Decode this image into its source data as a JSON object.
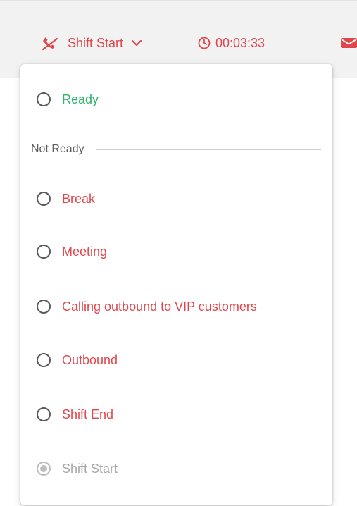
{
  "header": {
    "status_label": "Shift Start",
    "timer": "00:03:33"
  },
  "icons": {
    "status": "phone-off-icon",
    "toggle": "chevron-down-icon",
    "timer": "clock-icon",
    "mail": "mail-icon"
  },
  "colors": {
    "accent_red": "#e0474c",
    "ready_green": "#2cb56b",
    "disabled_gray": "#a8a8a8"
  },
  "menu": {
    "ready": {
      "label": "Ready",
      "selected": false
    },
    "not_ready_section": "Not Ready",
    "not_ready_options": [
      {
        "label": "Break",
        "selected": false
      },
      {
        "label": "Meeting",
        "selected": false
      },
      {
        "label": "Calling outbound to VIP customers",
        "selected": false
      },
      {
        "label": "Outbound",
        "selected": false
      },
      {
        "label": "Shift End",
        "selected": false
      }
    ],
    "current": {
      "label": "Shift Start",
      "selected": true
    }
  }
}
